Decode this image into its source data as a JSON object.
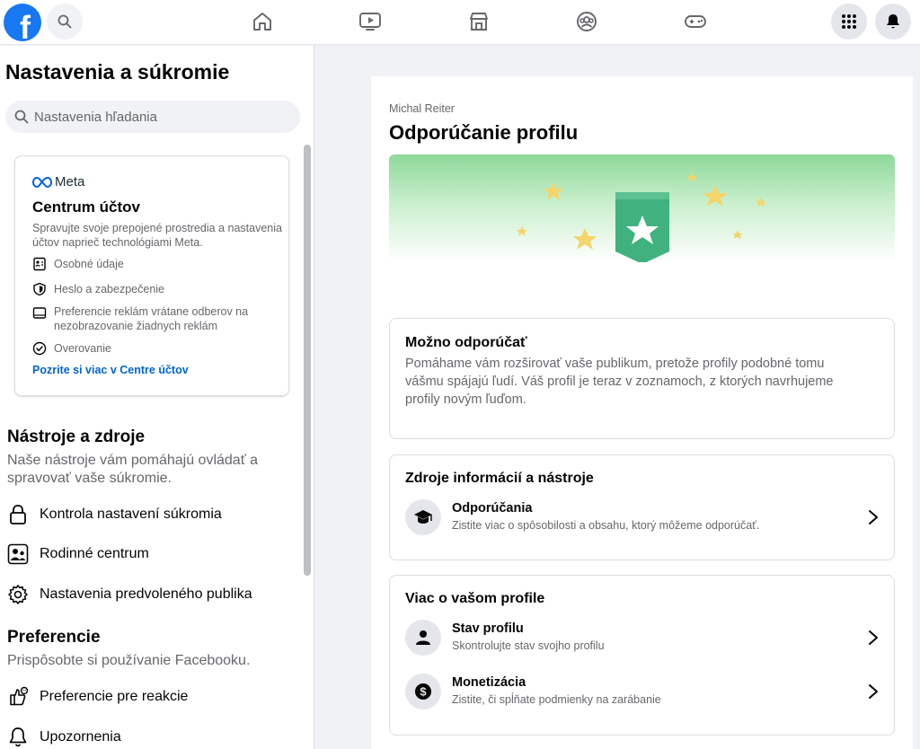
{
  "topnav": {
    "logo_letter": "f",
    "icons": [
      "search-icon",
      "home-icon",
      "video-icon",
      "marketplace-icon",
      "groups-icon",
      "gaming-icon",
      "menu-grid-icon",
      "notifications-bell-icon"
    ]
  },
  "sidebar": {
    "title": "Nastavenia a súkromie",
    "search_placeholder": "Nastavenia hľadania",
    "meta_card": {
      "brand": "Meta",
      "title": "Centrum účtov",
      "description": "Spravujte svoje prepojené prostredia a nastavenia účtov naprieč technológiami Meta.",
      "items": [
        {
          "label": "Osobné údaje",
          "icon": "id-card-icon"
        },
        {
          "label": "Heslo a zabezpečenie",
          "icon": "shield-icon"
        },
        {
          "label": "Preferencie reklám vrátane odberov na nezobrazovanie žiadnych reklám",
          "icon": "monitor-icon"
        },
        {
          "label": "Overovanie",
          "icon": "check-circle-icon"
        }
      ],
      "link": "Pozrite si viac v Centre účtov"
    },
    "tools": {
      "title": "Nástroje a zdroje",
      "description": "Naše nástroje vám pomáhajú ovládať a spravovať vaše súkromie.",
      "items": [
        {
          "label": "Kontrola nastavení súkromia",
          "icon": "lock-icon"
        },
        {
          "label": "Rodinné centrum",
          "icon": "family-icon"
        },
        {
          "label": "Nastavenia predvoleného publika",
          "icon": "gear-icon"
        }
      ]
    },
    "preferences": {
      "title": "Preferencie",
      "description": "Prispôsobte si používanie Facebooku.",
      "items": [
        {
          "label": "Preferencie pre reakcie",
          "icon": "reaction-icon"
        },
        {
          "label": "Upozornenia",
          "icon": "bell-icon"
        }
      ]
    }
  },
  "main": {
    "profile_name": "Michal Reiter",
    "title": "Odporúčanie profilu",
    "eligible_card": {
      "title": "Možno odporúčať",
      "text": "Pomáhame vám rozširovať vaše publikum, pretože profily podobné tomu vášmu spájajú ľudí. Váš profil je teraz v zoznamoch, z ktorých navrhujeme profily novým ľuďom."
    },
    "resources_card": {
      "title": "Zdroje informácií a nástroje",
      "rows": [
        {
          "title": "Odporúčania",
          "subtitle": "Zistite viac o spôsobilosti a obsahu, ktorý môžeme odporúčať.",
          "icon": "graduation-cap-icon"
        }
      ]
    },
    "profile_card": {
      "title": "Viac o vašom profile",
      "rows": [
        {
          "title": "Stav profilu",
          "subtitle": "Skontrolujte stav svojho profilu",
          "icon": "person-icon"
        },
        {
          "title": "Monetizácia",
          "subtitle": "Zistite, či spĺňate podmienky na zarábanie",
          "icon": "dollar-icon"
        }
      ]
    }
  },
  "colors": {
    "brand_blue": "#1877f2",
    "link_blue": "#0064d1",
    "badge_green": "#3fb27f",
    "star_yellow": "#f7d774"
  }
}
